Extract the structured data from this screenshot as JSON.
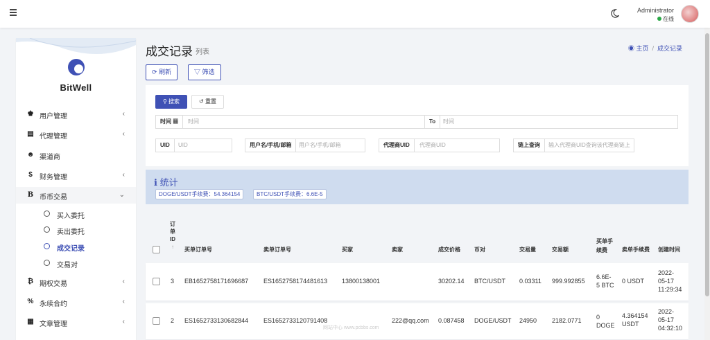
{
  "header": {
    "admin_name": "Administrator",
    "status": "在线",
    "menu_icon": "hamburger-icon",
    "theme_icon": "moon-icon"
  },
  "sidebar": {
    "brand": "BitWell",
    "items": [
      {
        "label": "用户管理",
        "icon": "user-group-icon",
        "chev": "‹"
      },
      {
        "label": "代理管理",
        "icon": "id-card-icon",
        "chev": "‹"
      },
      {
        "label": "渠道商",
        "icon": "user-circle-icon",
        "chev": ""
      },
      {
        "label": "财务管理",
        "icon": "dollar-icon",
        "chev": "‹"
      },
      {
        "label": "币币交易",
        "icon": "bitcoin-icon",
        "chev": "⌄"
      },
      {
        "label": "期权交易",
        "icon": "bitcoin-icon",
        "chev": "‹"
      },
      {
        "label": "永续合约",
        "icon": "link-icon",
        "chev": "‹"
      },
      {
        "label": "文章管理",
        "icon": "newspaper-icon",
        "chev": "‹"
      }
    ],
    "subitems": [
      {
        "label": "买入委托"
      },
      {
        "label": "卖出委托"
      },
      {
        "label": "成交记录"
      },
      {
        "label": "交易对"
      }
    ]
  },
  "page": {
    "title": "成交记录",
    "subtitle": "列表",
    "breadcrumb_home": "主页",
    "breadcrumb_current": "成交记录",
    "refresh_label": "刷新",
    "filter_label": "筛选"
  },
  "search": {
    "search_label": "搜索",
    "reset_label": "重置",
    "time_label": "时间",
    "time_ph": "时间",
    "to_label": "To",
    "to_ph": "时间",
    "uid_label": "UID",
    "uid_ph": "UID",
    "user_label": "用户名/手机/邮箱",
    "user_ph": "用户名/手机/邮箱",
    "agent_label": "代理商UID",
    "agent_ph": "代理商UID",
    "chain_label": "链上查询",
    "chain_ph": "输入代理商UID查询该代理商链上"
  },
  "stats": {
    "title": "统计",
    "doge_fee": "DOGE/USDT手续费：54.364154",
    "btc_fee": "BTC/USDT手续费：6.6E-5"
  },
  "table": {
    "headers": {
      "id": "订单ID",
      "id_lines": [
        "订",
        "单",
        "ID"
      ],
      "sort": "↑",
      "buy_order": "买单订单号",
      "sell_order": "卖单订单号",
      "buyer": "买家",
      "seller": "卖家",
      "price": "成交价格",
      "pair": "币对",
      "amount": "交易量",
      "total": "交易额",
      "buy_fee_l1": "买单手",
      "buy_fee_l2": "续费",
      "sell_fee": "卖单手续费",
      "created": "创建时间"
    },
    "rows": [
      {
        "id": "3",
        "buy_order": "EB1652758171696687",
        "sell_order": "ES1652758174481613",
        "buyer": "13800138001",
        "seller": "",
        "price": "30202.14",
        "pair": "BTC/USDT",
        "amount": "0.03311",
        "total": "999.992855",
        "buy_fee_l1": "6.6E-",
        "buy_fee_l2": "5 BTC",
        "sell_fee_l1": "0 USDT",
        "sell_fee_l2": "",
        "date_l1": "2022-",
        "date_l2": "05-17",
        "date_l3": "11:29:34"
      },
      {
        "id": "2",
        "buy_order": "ES1652733130682844",
        "sell_order": "ES1652733120791408",
        "buyer": "",
        "seller": "222@qq.com",
        "price": "0.087458",
        "pair": "DOGE/USDT",
        "amount": "24950",
        "total": "2182.0771",
        "buy_fee_l1": "0",
        "buy_fee_l2": "DOGE",
        "sell_fee_l1": "4.364154",
        "sell_fee_l2": "USDT",
        "date_l1": "2022-",
        "date_l2": "05-17",
        "date_l3": "04:32:10"
      }
    ]
  },
  "watermark": "网站中心 www.pcbbs.com"
}
